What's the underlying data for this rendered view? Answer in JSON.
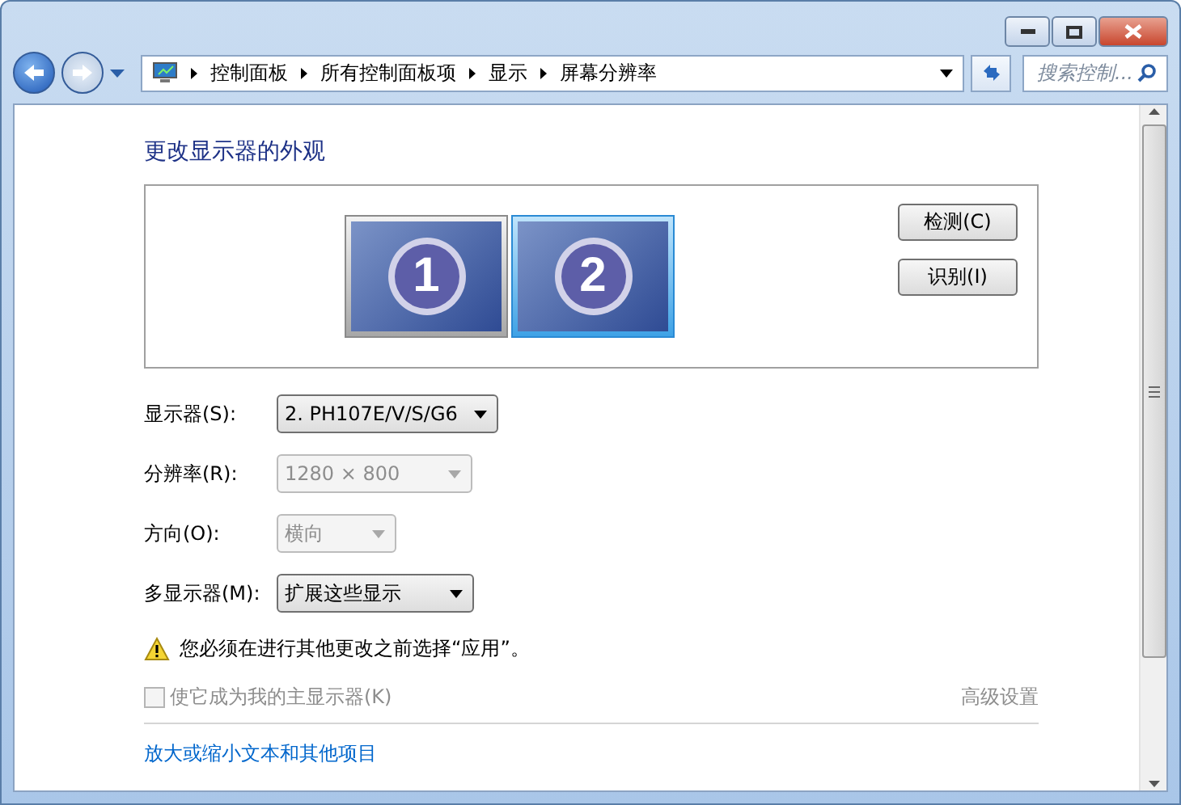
{
  "address_bar": {
    "crumbs": [
      "控制面板",
      "所有控制面板项",
      "显示",
      "屏幕分辨率"
    ]
  },
  "search": {
    "placeholder": "搜索控制..."
  },
  "title": "更改显示器的外观",
  "monitors": [
    {
      "number": "1",
      "selected": false
    },
    {
      "number": "2",
      "selected": true
    }
  ],
  "side_buttons": [
    "检测(C)",
    "识别(I)"
  ],
  "settings": [
    {
      "label": "显示器(S):",
      "value": "2. PH107E/V/S/G6",
      "disabled": false
    },
    {
      "label": "分辨率(R):",
      "value": "1280 × 800",
      "disabled": true
    },
    {
      "label": "方向(O):",
      "value": "横向",
      "disabled": true
    },
    {
      "label": "多显示器(M):",
      "value": "扩展这些显示",
      "disabled": false
    }
  ],
  "warning": "您必须在进行其他更改之前选择“应用”。",
  "primary_checkbox": {
    "label": "使它成为我的主显示器(K)",
    "checked": false,
    "disabled": true
  },
  "advanced_link": {
    "label": "高级设置",
    "disabled": true
  },
  "links": [
    "放大或缩小文本和其他项目"
  ]
}
